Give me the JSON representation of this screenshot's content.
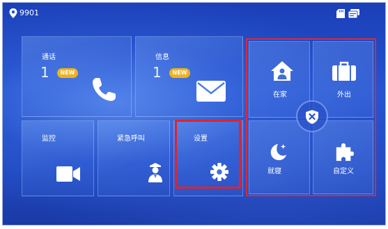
{
  "statusbar": {
    "room_number": "9901",
    "icons": [
      "location-pin-icon",
      "sd-card-icon",
      "id-card-icon"
    ]
  },
  "tiles": {
    "call": {
      "label": "通话",
      "count": "1",
      "badge": "NEW",
      "icon": "phone-icon"
    },
    "message": {
      "label": "信息",
      "count": "1",
      "badge": "NEW",
      "icon": "envelope-icon"
    },
    "monitor": {
      "label": "监控",
      "icon": "video-camera-icon"
    },
    "emergency": {
      "label": "紧急呼叫",
      "icon": "guard-icon"
    },
    "settings": {
      "label": "设置",
      "icon": "gear-icon"
    }
  },
  "modes": {
    "home": {
      "label": "在家",
      "icon": "home-person-icon"
    },
    "away": {
      "label": "外出",
      "icon": "briefcase-icon"
    },
    "sleep": {
      "label": "就寝",
      "icon": "moon-stars-icon"
    },
    "custom": {
      "label": "自定义",
      "icon": "puzzle-icon"
    },
    "disarm_icon": "shield-x-icon"
  },
  "colors": {
    "highlight": "#e0242c",
    "badge": "#f0b21c",
    "background": "#2553cf"
  }
}
